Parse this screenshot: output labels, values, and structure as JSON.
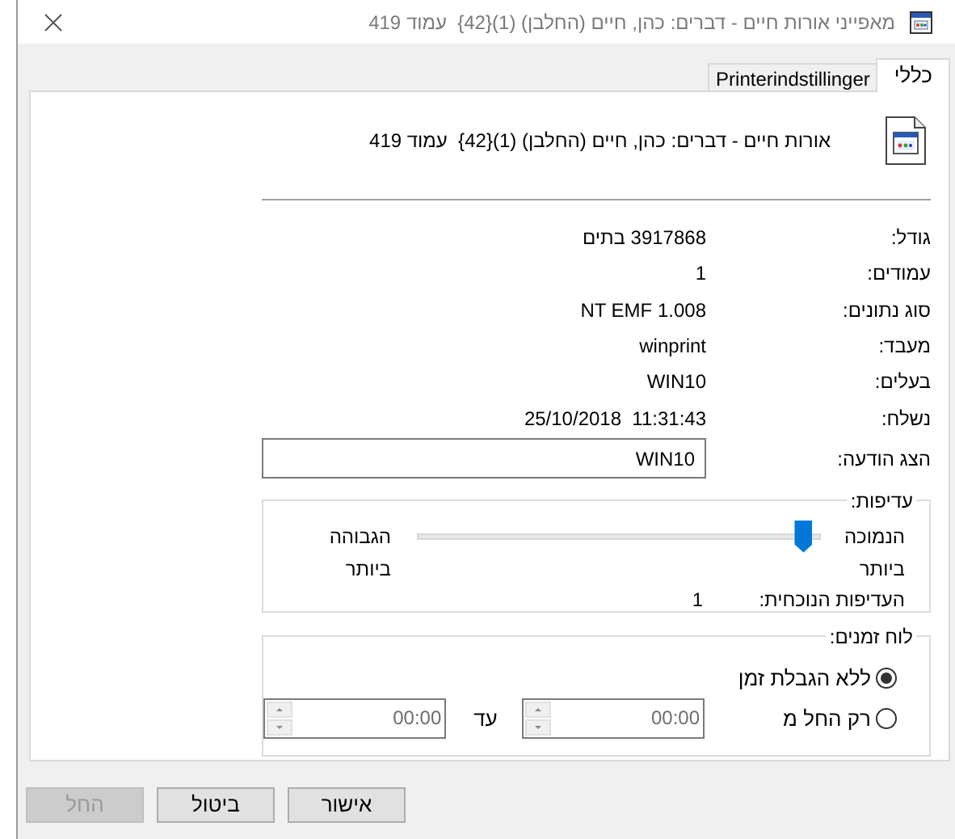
{
  "window": {
    "title": "מאפייני אורות חיים - דברים: כהן, חיים (החלבן) (1){42}  עמוד 419"
  },
  "tabs": [
    {
      "label": "כללי",
      "selected": true
    },
    {
      "label": "Printerindstillinger",
      "selected": false
    }
  ],
  "document_name": "אורות חיים - דברים: כהן, חיים (החלבן) (1){42}  עמוד 419",
  "details": [
    {
      "label": "גודל:",
      "value": "3917868 בתים"
    },
    {
      "label": "עמודים:",
      "value": "1"
    },
    {
      "label": "סוג נתונים:",
      "value": "NT EMF 1.008"
    },
    {
      "label": "מעבד:",
      "value": "winprint"
    },
    {
      "label": "בעלים:",
      "value": "WIN10"
    },
    {
      "label": "נשלח:",
      "value": "25/10/2018  11:31:43"
    }
  ],
  "notify": {
    "label": "הצג הודעה:",
    "value": "WIN10"
  },
  "priority": {
    "title": "עדיפות:",
    "low_label": "הנמוכה ביותר",
    "high_label": "הגבוהה ביותר",
    "level": 0.02,
    "current_label": "העדיפות הנוכחית:",
    "current_value": "1"
  },
  "schedule": {
    "title": "לוח זמנים:",
    "options": [
      {
        "label": "ללא הגבלת זמן",
        "selected": true
      },
      {
        "label": "רק החל מ",
        "selected": false
      }
    ],
    "from": "00:00",
    "to_label": "עד",
    "to": "00:00"
  },
  "buttons": [
    {
      "label": "אישור",
      "disabled": false
    },
    {
      "label": "ביטול",
      "disabled": false
    },
    {
      "label": "החל",
      "disabled": true
    }
  ]
}
